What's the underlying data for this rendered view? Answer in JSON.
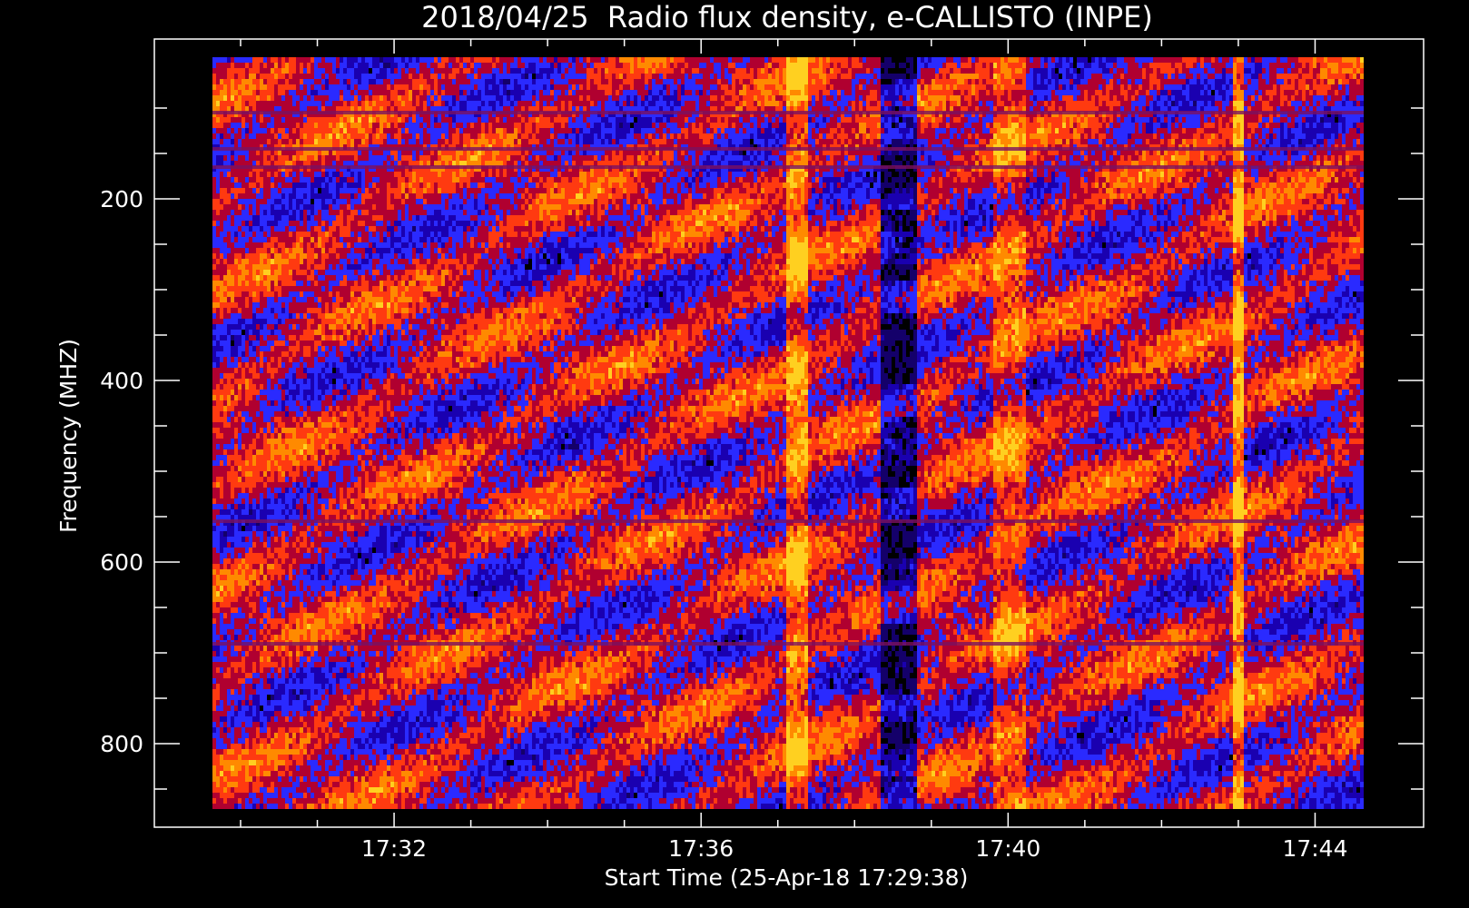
{
  "chart_data": {
    "type": "heatmap",
    "title": "2018/04/25  Radio flux density, e-CALLISTO (INPE)",
    "xlabel": "Start Time (25-Apr-18 17:29:38)",
    "ylabel": "Frequency (MHZ)",
    "x_tick_labels": [
      "17:32",
      "17:36",
      "17:40",
      "17:44"
    ],
    "y_tick_labels": [
      "200",
      "400",
      "600",
      "800"
    ],
    "xlim": [
      "17:29:38",
      "17:44:38"
    ],
    "ylim": [
      870,
      45
    ],
    "y_axis_inverted": true,
    "colormap": [
      "#000000",
      "#1a00b0",
      "#2a2aff",
      "#b00030",
      "#ff3a10",
      "#ff8a00",
      "#ffd020"
    ],
    "background_color": "#000000",
    "vertical_features": [
      {
        "time": "17:37:13",
        "kind": "broadband bright column"
      },
      {
        "time": "17:38:34",
        "kind": "dark gap with blue arches"
      },
      {
        "time": "17:40:00",
        "kind": "bright arched emission"
      },
      {
        "time": "17:42:58",
        "kind": "bright narrow column"
      }
    ],
    "horizontal_features": [
      {
        "frequency": 105,
        "kind": "interference line"
      },
      {
        "frequency": 145,
        "kind": "interference line"
      },
      {
        "frequency": 165,
        "kind": "interference line"
      },
      {
        "frequency": 555,
        "kind": "interference line"
      },
      {
        "frequency": 690,
        "kind": "interference line"
      }
    ],
    "grid": false,
    "legend": "none"
  }
}
